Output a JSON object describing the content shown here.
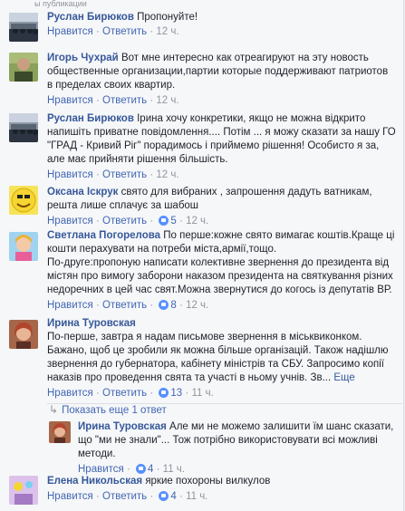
{
  "header_fragment": "ы публикации",
  "comments": [
    {
      "name": "Руслан Бирюков",
      "text": "Пропонуйте!",
      "like": "Нравится",
      "reply": "Ответить",
      "time": "12 ч.",
      "likes": ""
    },
    {
      "name": "Игорь Чухрай",
      "text": "Вот мне интересно как отреагируют на эту новость общественные организации,партии которые поддерживают патриотов в пределах своих квартир.",
      "like": "Нравится",
      "reply": "Ответить",
      "time": "12 ч.",
      "likes": ""
    },
    {
      "name": "Руслан Бирюков",
      "text": "Ірина хочу конкретики, якщо не можна відкрито напишіть приватне повідомлення.... Потім ... я можу сказати за нашу ГО \"ГРАД - Кривий Ріг\" порадимось і приймемо рішення! Особисто я за, але має прийняти рішення більшість.",
      "like": "Нравится",
      "reply": "Ответить",
      "time": "12 ч.",
      "likes": ""
    },
    {
      "name": "Оксана Іскрук",
      "text": "свято для вибраних , запрошення дадуть ватникам, решта лише сплачує за шабош",
      "like": "Нравится",
      "reply": "Ответить",
      "time": "12 ч.",
      "likes": "5"
    },
    {
      "name": "Светлана Погорелова",
      "text": "По перше:кожне свято вимагає коштів.Краще ці кошти перахувати на потреби міста,армії,тощо.",
      "text2": "По-друге:пропоную написати колективне звернення до президента від містян про вимогу заборони наказом президента на святкування різних недоречних в цей час свят.Можна звернутися до когось із депутатів ВР.",
      "like": "Нравится",
      "reply": "Ответить",
      "time": "12 ч.",
      "likes": "8"
    },
    {
      "name": "Ирина Туровская",
      "text": "По-перше, завтра я надам письмове звернення в міськвиконком. Бажано, щоб це зробили як можна більше організацій. Також надішлю звернення до губернатора, кабінету міністрів та СБУ. Запросимо копії наказів про проведення свята та участі в ньому учнів. Зв...",
      "more": "Еще",
      "like": "Нравится",
      "reply": "Ответить",
      "time": "11 ч.",
      "likes": "13"
    }
  ],
  "show_replies": "Показать еще 1 ответ",
  "reply": {
    "name": "Ирина Туровская",
    "text": "Але ми не можемо залишити їм шанс сказати, що \"ми не знали\"... Тож потрібно використовувати всі можливі методи.",
    "like": "Нравится",
    "time": "11 ч.",
    "likes": "4"
  },
  "last": {
    "name": "Елена Никольская",
    "text": "яркие похороны вилкулов",
    "like": "Нравится",
    "reply": "Ответить",
    "time": "11 ч.",
    "likes": "4"
  },
  "colors": {
    "name": "#365899",
    "link": "#4267b2",
    "meta": "#90949c",
    "text": "#1d2129",
    "bg": "#f6f7f9"
  }
}
